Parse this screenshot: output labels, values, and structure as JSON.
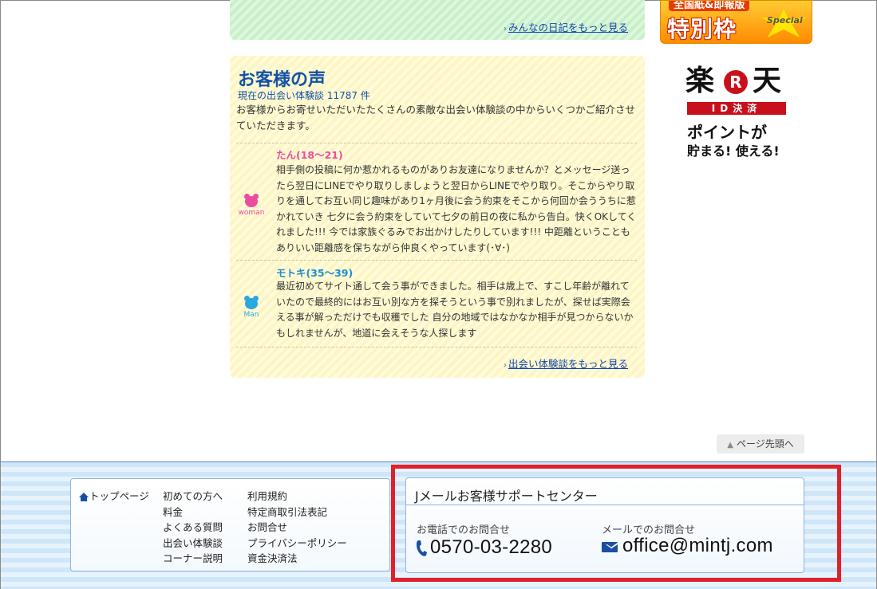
{
  "diary": {
    "more_link": "みんなの日記をもっと見る"
  },
  "ads": {
    "tokubetsu": {
      "top_text": "全国紙&即報版",
      "big_text": "特別枠",
      "badge": "Special"
    },
    "rakuten": {
      "left_kanji": "楽",
      "r_mark": "R",
      "right_kanji": "天",
      "id_text": "ID決済",
      "line1": "ポイントが",
      "line2": "貯まる! 使える!"
    }
  },
  "voice": {
    "title": "お客様の声",
    "count": "現在の出会い体験談 11787 件",
    "intro": "お客様からお寄せいただいたたくさんの素敵な出会い体験談の中からいくつかご紹介させていただきます。",
    "entries": [
      {
        "icon": "bear-woman-icon",
        "icon_label": "woman",
        "name": "たん(18〜21)",
        "text": "相手側の投稿に何か惹かれるものがありお友達になりませんか？とメッセージ送ったら翌日にLINEでやり取りしましょうと翌日からLINEでやり取り。そこからやり取りを通してお互い同じ趣味があり1ヶ月後に会う約束をそこから何回か会ううちに惹かれていき 七夕に会う約束をしていて七夕の前日の夜に私から告白。快くOKしてくれました!!! 今では家族ぐるみでお出かけしたりしています!!! 中距離ということもありいい距離感を保ちながら仲良くやっています(･∀･)"
      },
      {
        "icon": "bear-man-icon",
        "icon_label": "Man",
        "name": "モトキ(35〜39)",
        "text": "最近初めてサイト通して会う事ができました。相手は歳上で、すこし年齢が離れていたので最終的にはお互い別な方を探そうという事で別れましたが、探せば実際会える事が解っただけでも収穫でした 自分の地域ではなかなか相手が見つからないかもしれませんが、地道に会えそうな人探します"
      }
    ],
    "more_link": "出会い体験談をもっと見る"
  },
  "page_top": "ページ先頭へ",
  "footer": {
    "nav": {
      "home": "トップページ",
      "col1": [
        "初めての方へ",
        "料金",
        "よくある質問",
        "出会い体験談",
        "コーナー説明"
      ],
      "col2": [
        "利用規約",
        "特定商取引法表記",
        "お問合せ",
        "プライバシーポリシー",
        "資金決済法"
      ]
    },
    "support": {
      "title": "Jメールお客様サポートセンター",
      "phone_label": "お電話でのお問合せ",
      "phone": "0570-03-2280",
      "mail_label": "メールでのお問合せ",
      "mail": "office@mintj.com"
    }
  },
  "colors": {
    "woman": "#ee4aa0",
    "man": "#29a8e0",
    "highlight": "#e0202a",
    "link": "#1144aa"
  }
}
